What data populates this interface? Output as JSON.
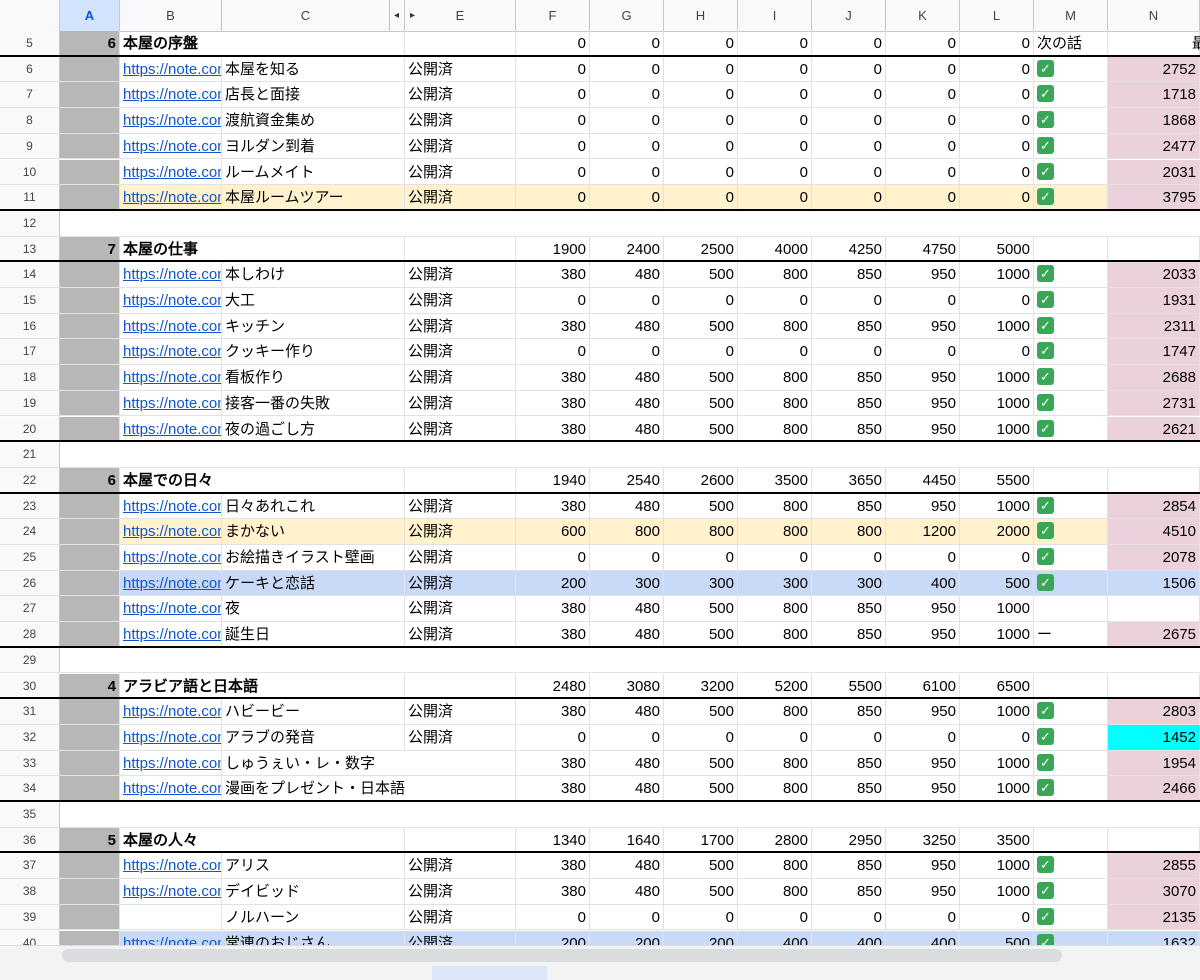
{
  "columns": [
    "A",
    "B",
    "C",
    "",
    "E",
    "F",
    "G",
    "H",
    "I",
    "J",
    "K",
    "L",
    "M",
    "N"
  ],
  "m5_label": "次の話",
  "overflow_char": "最",
  "check_glyph": "✓",
  "dash_glyph": "ー",
  "link_text": "https://note.com",
  "status_published": "公開済",
  "rows": [
    {
      "n": "5",
      "type": "section",
      "a": "6",
      "title": "本屋の序盤",
      "vals": [
        "0",
        "0",
        "0",
        "0",
        "0",
        "0",
        "0"
      ],
      "m": "次の話",
      "nv": ""
    },
    {
      "n": "6",
      "type": "item",
      "link": true,
      "title": "本屋を知る",
      "status": true,
      "vals": [
        "0",
        "0",
        "0",
        "0",
        "0",
        "0",
        "0"
      ],
      "m": "check",
      "nv": "2752",
      "nc": "pink"
    },
    {
      "n": "7",
      "type": "item",
      "link": true,
      "title": "店長と面接",
      "status": true,
      "vals": [
        "0",
        "0",
        "0",
        "0",
        "0",
        "0",
        "0"
      ],
      "m": "check",
      "nv": "1718",
      "nc": "pink"
    },
    {
      "n": "8",
      "type": "item",
      "link": true,
      "title": "渡航資金集め",
      "status": true,
      "vals": [
        "0",
        "0",
        "0",
        "0",
        "0",
        "0",
        "0"
      ],
      "m": "check",
      "nv": "1868",
      "nc": "pink"
    },
    {
      "n": "9",
      "type": "item",
      "link": true,
      "title": "ヨルダン到着",
      "status": true,
      "vals": [
        "0",
        "0",
        "0",
        "0",
        "0",
        "0",
        "0"
      ],
      "m": "check",
      "nv": "2477",
      "nc": "pink"
    },
    {
      "n": "10",
      "type": "item",
      "link": true,
      "title": "ルームメイト",
      "status": true,
      "vals": [
        "0",
        "0",
        "0",
        "0",
        "0",
        "0",
        "0"
      ],
      "m": "check",
      "nv": "2031",
      "nc": "pink"
    },
    {
      "n": "11",
      "type": "item",
      "hl": "yellow",
      "link": true,
      "title": "本屋ルームツアー",
      "status": true,
      "vals": [
        "0",
        "0",
        "0",
        "0",
        "0",
        "0",
        "0"
      ],
      "m": "check",
      "nv": "3795",
      "nc": "pink"
    },
    {
      "n": "12",
      "type": "blank"
    },
    {
      "n": "13",
      "type": "section",
      "a": "7",
      "title": "本屋の仕事",
      "vals": [
        "1900",
        "2400",
        "2500",
        "4000",
        "4250",
        "4750",
        "5000"
      ],
      "m": "",
      "nv": ""
    },
    {
      "n": "14",
      "type": "item",
      "link": true,
      "title": "本しわけ",
      "status": true,
      "vals": [
        "380",
        "480",
        "500",
        "800",
        "850",
        "950",
        "1000"
      ],
      "m": "check",
      "nv": "2033",
      "nc": "pink"
    },
    {
      "n": "15",
      "type": "item",
      "link": true,
      "title": "大工",
      "status": true,
      "vals": [
        "0",
        "0",
        "0",
        "0",
        "0",
        "0",
        "0"
      ],
      "m": "check",
      "nv": "1931",
      "nc": "pink"
    },
    {
      "n": "16",
      "type": "item",
      "link": true,
      "title": "キッチン",
      "status": true,
      "vals": [
        "380",
        "480",
        "500",
        "800",
        "850",
        "950",
        "1000"
      ],
      "m": "check",
      "nv": "2311",
      "nc": "pink"
    },
    {
      "n": "17",
      "type": "item",
      "link": true,
      "title": "クッキー作り",
      "status": true,
      "vals": [
        "0",
        "0",
        "0",
        "0",
        "0",
        "0",
        "0"
      ],
      "m": "check",
      "nv": "1747",
      "nc": "pink"
    },
    {
      "n": "18",
      "type": "item",
      "link": true,
      "title": "看板作り",
      "status": true,
      "vals": [
        "380",
        "480",
        "500",
        "800",
        "850",
        "950",
        "1000"
      ],
      "m": "check",
      "nv": "2688",
      "nc": "pink"
    },
    {
      "n": "19",
      "type": "item",
      "link": true,
      "title": "接客一番の失敗",
      "status": true,
      "vals": [
        "380",
        "480",
        "500",
        "800",
        "850",
        "950",
        "1000"
      ],
      "m": "check",
      "nv": "2731",
      "nc": "pink"
    },
    {
      "n": "20",
      "type": "item",
      "link": true,
      "title": "夜の過ごし方",
      "status": true,
      "vals": [
        "380",
        "480",
        "500",
        "800",
        "850",
        "950",
        "1000"
      ],
      "m": "check",
      "nv": "2621",
      "nc": "pink"
    },
    {
      "n": "21",
      "type": "blank"
    },
    {
      "n": "22",
      "type": "section",
      "a": "6",
      "title": "本屋での日々",
      "vals": [
        "1940",
        "2540",
        "2600",
        "3500",
        "3650",
        "4450",
        "5500"
      ],
      "m": "",
      "nv": ""
    },
    {
      "n": "23",
      "type": "item",
      "link": true,
      "title": "日々あれこれ",
      "status": true,
      "vals": [
        "380",
        "480",
        "500",
        "800",
        "850",
        "950",
        "1000"
      ],
      "m": "check",
      "nv": "2854",
      "nc": "pink"
    },
    {
      "n": "24",
      "type": "item",
      "hl": "yellow",
      "link": true,
      "title": "まかない",
      "status": true,
      "vals": [
        "600",
        "800",
        "800",
        "800",
        "800",
        "1200",
        "2000"
      ],
      "m": "check",
      "nv": "4510",
      "nc": "pink"
    },
    {
      "n": "25",
      "type": "item",
      "link": true,
      "title": "お絵描きイラスト壁画",
      "status": true,
      "vals": [
        "0",
        "0",
        "0",
        "0",
        "0",
        "0",
        "0"
      ],
      "m": "check",
      "nv": "2078",
      "nc": "pink"
    },
    {
      "n": "26",
      "type": "item",
      "hl": "blue",
      "link": true,
      "title": "ケーキと恋話",
      "status": true,
      "vals": [
        "200",
        "300",
        "300",
        "300",
        "300",
        "400",
        "500"
      ],
      "m": "check",
      "nv": "1506",
      "nc": ""
    },
    {
      "n": "27",
      "type": "item",
      "link": true,
      "title": "夜",
      "status": true,
      "vals": [
        "380",
        "480",
        "500",
        "800",
        "850",
        "950",
        "1000"
      ],
      "m": "",
      "nv": "",
      "nc": ""
    },
    {
      "n": "28",
      "type": "item",
      "link": true,
      "title": "誕生日",
      "status": true,
      "vals": [
        "380",
        "480",
        "500",
        "800",
        "850",
        "950",
        "1000"
      ],
      "m": "dash",
      "nv": "2675",
      "nc": "pink"
    },
    {
      "n": "29",
      "type": "blank"
    },
    {
      "n": "30",
      "type": "section",
      "a": "4",
      "title": "アラビア語と日本語",
      "vals": [
        "2480",
        "3080",
        "3200",
        "5200",
        "5500",
        "6100",
        "6500"
      ],
      "m": "",
      "nv": ""
    },
    {
      "n": "31",
      "type": "item",
      "link": true,
      "title": "ハビービー",
      "status": true,
      "vals": [
        "380",
        "480",
        "500",
        "800",
        "850",
        "950",
        "1000"
      ],
      "m": "check",
      "nv": "2803",
      "nc": "pink"
    },
    {
      "n": "32",
      "type": "item",
      "link": true,
      "title": "アラブの発音",
      "status": true,
      "vals": [
        "0",
        "0",
        "0",
        "0",
        "0",
        "0",
        "0"
      ],
      "m": "check",
      "nv": "1452",
      "nc": "cyan"
    },
    {
      "n": "33",
      "type": "item",
      "link": true,
      "title": "しゅうぇい・レ・数字",
      "status": false,
      "vals": [
        "380",
        "480",
        "500",
        "800",
        "850",
        "950",
        "1000"
      ],
      "m": "check",
      "nv": "1954",
      "nc": "pink"
    },
    {
      "n": "34",
      "type": "item",
      "link": true,
      "title": "漫画をプレゼント・日本語",
      "status": false,
      "vals": [
        "380",
        "480",
        "500",
        "800",
        "850",
        "950",
        "1000"
      ],
      "m": "check",
      "nv": "2466",
      "nc": "pink"
    },
    {
      "n": "35",
      "type": "blank"
    },
    {
      "n": "36",
      "type": "section",
      "a": "5",
      "title": "本屋の人々",
      "vals": [
        "1340",
        "1640",
        "1700",
        "2800",
        "2950",
        "3250",
        "3500"
      ],
      "m": "",
      "nv": ""
    },
    {
      "n": "37",
      "type": "item",
      "link": true,
      "title": "アリス",
      "status": true,
      "vals": [
        "380",
        "480",
        "500",
        "800",
        "850",
        "950",
        "1000"
      ],
      "m": "check",
      "nv": "2855",
      "nc": "pink"
    },
    {
      "n": "38",
      "type": "item",
      "link": true,
      "title": "デイビッド",
      "status": true,
      "vals": [
        "380",
        "480",
        "500",
        "800",
        "850",
        "950",
        "1000"
      ],
      "m": "check",
      "nv": "3070",
      "nc": "pink"
    },
    {
      "n": "39",
      "type": "item",
      "link": false,
      "title": "ノルハーン",
      "status": true,
      "vals": [
        "0",
        "0",
        "0",
        "0",
        "0",
        "0",
        "0"
      ],
      "m": "check",
      "nv": "2135",
      "nc": "pink"
    },
    {
      "n": "40",
      "type": "item",
      "hl": "blue",
      "link": true,
      "title": "常連のおじさん",
      "status": true,
      "vals": [
        "200",
        "200",
        "200",
        "400",
        "400",
        "400",
        "500"
      ],
      "m": "check",
      "nv": "1632",
      "nc": ""
    }
  ]
}
